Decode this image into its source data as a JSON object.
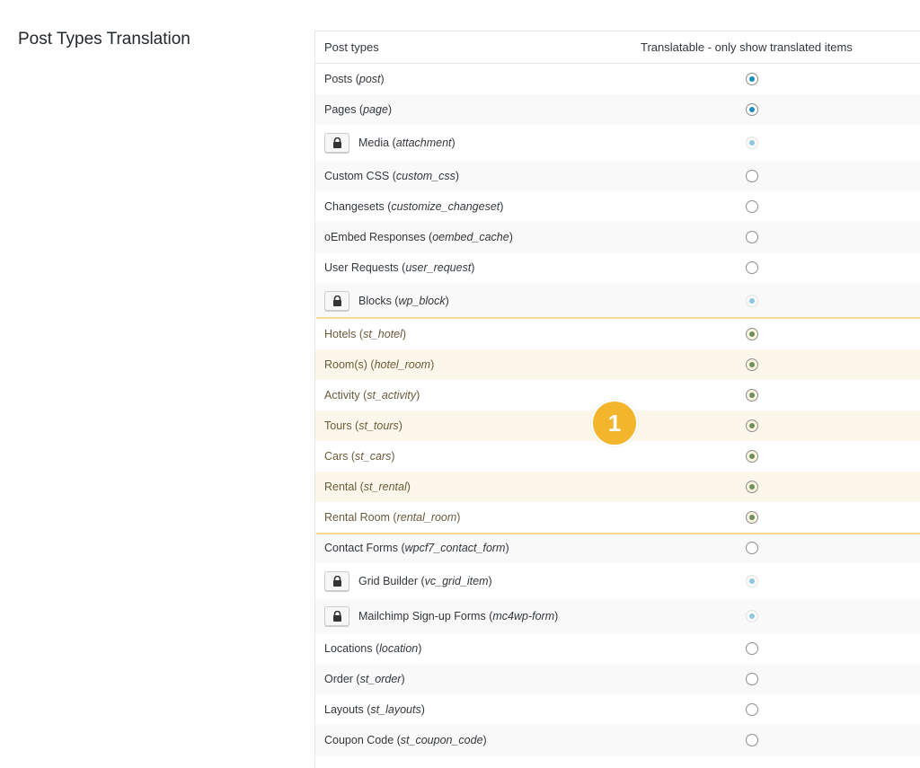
{
  "section": {
    "title": "Post Types Translation"
  },
  "table": {
    "col_post_types": "Post types",
    "col_translatable": "Translatable - only show translated items"
  },
  "rows": [
    {
      "name": "Posts",
      "slug": "post",
      "state": "checked",
      "locked": false,
      "highlight": false,
      "height": 35
    },
    {
      "name": "Pages",
      "slug": "page",
      "state": "checked",
      "locked": false,
      "highlight": false,
      "height": 34
    },
    {
      "name": "Media",
      "slug": "attachment",
      "state": "disabled-checked",
      "locked": true,
      "highlight": false,
      "height": 40
    },
    {
      "name": "Custom CSS",
      "slug": "custom_css",
      "state": "unchecked",
      "locked": false,
      "highlight": false,
      "height": 34
    },
    {
      "name": "Changesets",
      "slug": "customize_changeset",
      "state": "unchecked",
      "locked": false,
      "highlight": false,
      "height": 34
    },
    {
      "name": "oEmbed Responses",
      "slug": "oembed_cache",
      "state": "unchecked",
      "locked": false,
      "highlight": false,
      "height": 34
    },
    {
      "name": "User Requests",
      "slug": "user_request",
      "state": "unchecked",
      "locked": false,
      "highlight": false,
      "height": 34
    },
    {
      "name": "Blocks",
      "slug": "wp_block",
      "state": "disabled-checked",
      "locked": true,
      "highlight": false,
      "height": 40
    },
    {
      "name": "Hotels",
      "slug": "st_hotel",
      "state": "checked",
      "locked": false,
      "highlight": true,
      "height": 34
    },
    {
      "name": "Room(s)",
      "slug": "hotel_room",
      "state": "checked",
      "locked": false,
      "highlight": true,
      "height": 34
    },
    {
      "name": "Activity",
      "slug": "st_activity",
      "state": "checked",
      "locked": false,
      "highlight": true,
      "height": 34
    },
    {
      "name": "Tours",
      "slug": "st_tours",
      "state": "checked",
      "locked": false,
      "highlight": true,
      "height": 34
    },
    {
      "name": "Cars",
      "slug": "st_cars",
      "state": "checked",
      "locked": false,
      "highlight": true,
      "height": 34
    },
    {
      "name": "Rental",
      "slug": "st_rental",
      "state": "checked",
      "locked": false,
      "highlight": true,
      "height": 34
    },
    {
      "name": "Rental Room",
      "slug": "rental_room",
      "state": "checked",
      "locked": false,
      "highlight": true,
      "height": 34
    },
    {
      "name": "Contact Forms",
      "slug": "wpcf7_contact_form",
      "state": "unchecked",
      "locked": false,
      "highlight": false,
      "height": 34
    },
    {
      "name": "Grid Builder",
      "slug": "vc_grid_item",
      "state": "disabled-checked",
      "locked": true,
      "highlight": false,
      "height": 40
    },
    {
      "name": "Mailchimp Sign-up Forms",
      "slug": "mc4wp-form",
      "state": "disabled-checked",
      "locked": true,
      "highlight": false,
      "height": 38
    },
    {
      "name": "Locations",
      "slug": "location",
      "state": "unchecked",
      "locked": false,
      "highlight": false,
      "height": 34
    },
    {
      "name": "Order",
      "slug": "st_order",
      "state": "unchecked",
      "locked": false,
      "highlight": false,
      "height": 34
    },
    {
      "name": "Layouts",
      "slug": "st_layouts",
      "state": "unchecked",
      "locked": false,
      "highlight": false,
      "height": 34
    },
    {
      "name": "Coupon Code",
      "slug": "st_coupon_code",
      "state": "unchecked",
      "locked": false,
      "highlight": false,
      "height": 34
    }
  ],
  "annotation": {
    "marker_label": "1"
  },
  "colors": {
    "radio_checked": "#1e8cbe",
    "highlight_bg": "#fdebbe",
    "marker_bg": "#f2b52b"
  }
}
